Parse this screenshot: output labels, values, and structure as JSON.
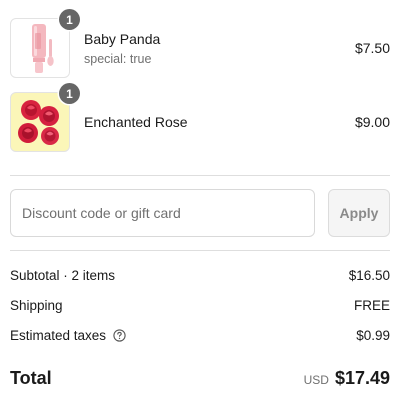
{
  "line_items": [
    {
      "name": "Baby Panda",
      "variant": "special: true",
      "price": "$7.50",
      "quantity": "1",
      "image": "pink-lip-gloss-tube"
    },
    {
      "name": "Enchanted Rose",
      "variant": "",
      "price": "$9.00",
      "quantity": "1",
      "image": "red-rose-gummies"
    }
  ],
  "discount": {
    "placeholder": "Discount code or gift card",
    "value": "",
    "apply_label": "Apply"
  },
  "summary": {
    "subtotal_label": "Subtotal · 2 items",
    "subtotal_value": "$16.50",
    "shipping_label": "Shipping",
    "shipping_value": "FREE",
    "taxes_label": "Estimated taxes",
    "taxes_icon": "question-circle-icon",
    "taxes_value": "$0.99"
  },
  "total": {
    "label": "Total",
    "currency": "USD",
    "value": "$17.49"
  },
  "colors": {
    "badge": "#666666",
    "divider": "#dedede",
    "muted_text": "#707070",
    "rose_background": "#fbf6b8"
  }
}
